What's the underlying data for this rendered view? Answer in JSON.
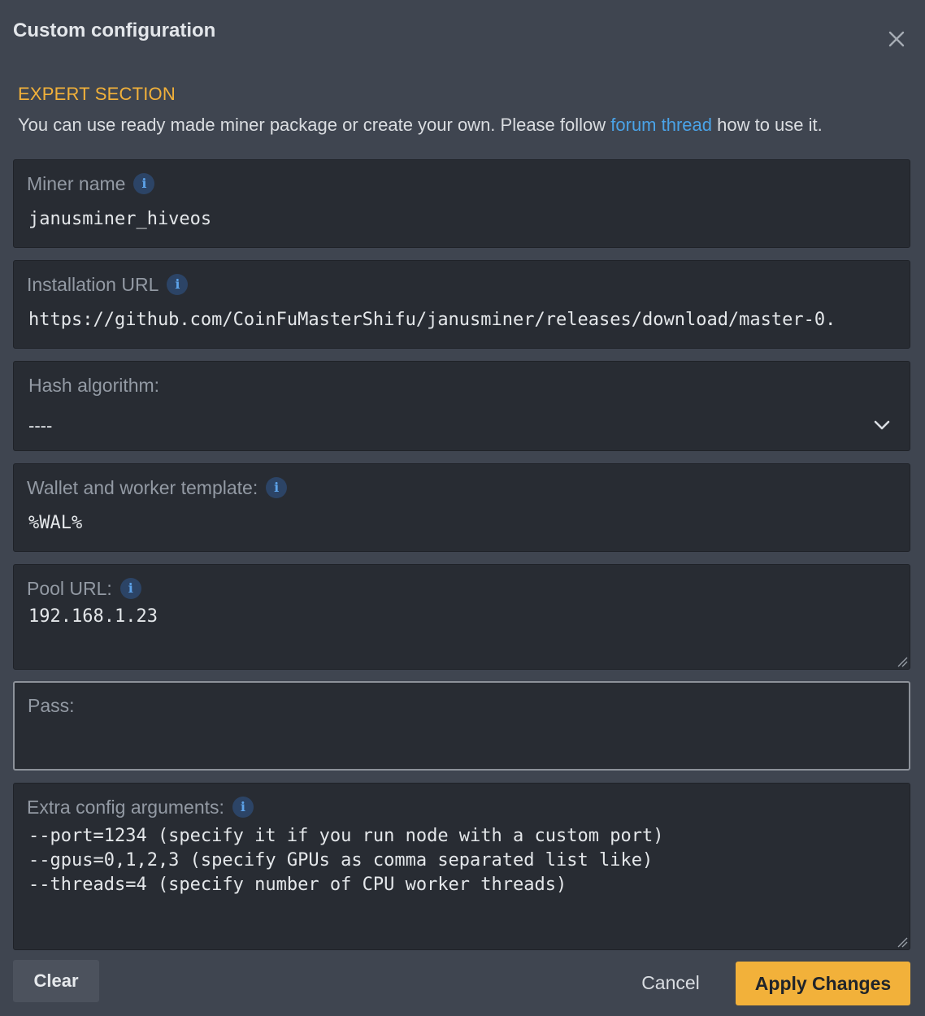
{
  "dialog": {
    "title": "Custom configuration"
  },
  "expert": {
    "heading": "EXPERT SECTION",
    "intro_before": "You can use ready made miner package or create your own. Please follow ",
    "intro_link": "forum thread",
    "intro_after": " how to use it."
  },
  "fields": {
    "miner_name": {
      "label": "Miner name",
      "value": "janusminer_hiveos"
    },
    "install_url": {
      "label": "Installation URL",
      "value": "https://github.com/CoinFuMasterShifu/janusminer/releases/download/master-0."
    },
    "hash_algorithm": {
      "label": "Hash algorithm:",
      "selected": "----"
    },
    "wallet_template": {
      "label": "Wallet and worker template:",
      "value": "%WAL%"
    },
    "pool_url": {
      "label": "Pool URL:",
      "value": "192.168.1.23"
    },
    "pass": {
      "label": "Pass:",
      "value": ""
    },
    "extra_config": {
      "label": "Extra config arguments:",
      "value": "--port=1234 (specify it if you run node with a custom port)\n--gpus=0,1,2,3 (specify GPUs as comma separated list like)\n--threads=4 (specify number of CPU worker threads)"
    }
  },
  "buttons": {
    "clear": "Clear",
    "cancel": "Cancel",
    "apply": "Apply Changes"
  },
  "icons": {
    "info": "i",
    "close": "close-icon",
    "chevron": "chevron-down-icon"
  },
  "colors": {
    "accent": "#f2b13a",
    "link": "#4aa3e8",
    "background": "#3f4550",
    "field_background": "#282c33"
  }
}
